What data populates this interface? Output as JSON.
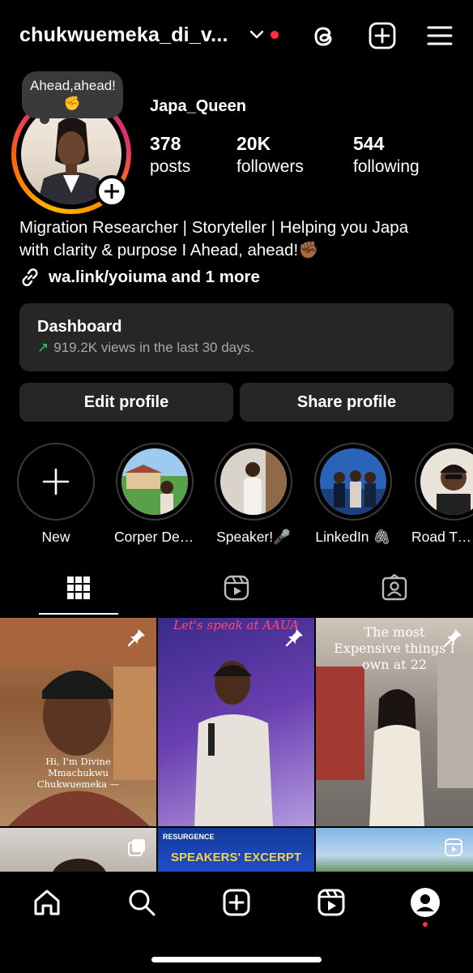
{
  "header": {
    "username": "chukwuemeka_di_v...",
    "icons": [
      "chevron-down-icon",
      "threads-icon",
      "create-plus-icon",
      "menu-icon"
    ],
    "notification_color": "#ff3040"
  },
  "profile": {
    "note": "Ahead,ahead!✊",
    "display_name": "Japa_Queen",
    "stats": [
      {
        "value": "378",
        "label": "posts"
      },
      {
        "value": "20K",
        "label": "followers"
      },
      {
        "value": "544",
        "label": "following"
      }
    ],
    "bio_line1": "Migration Researcher | Storyteller | Helping you Japa",
    "bio_line2": "with clarity & purpose I Ahead, ahead!✊🏾",
    "link_text": "wa.link/yoiuma and 1 more"
  },
  "dashboard": {
    "title": "Dashboard",
    "subtitle": "919.2K views in the last 30 days."
  },
  "buttons": {
    "edit": "Edit profile",
    "share": "Share profile"
  },
  "highlights": [
    {
      "label": "New"
    },
    {
      "label": "Corper Dee..."
    },
    {
      "label": "Speaker!🎤"
    },
    {
      "label": "LinkedIn 🖇"
    },
    {
      "label": "Road Trav"
    }
  ],
  "tabs": [
    "grid-icon",
    "reels-icon",
    "tagged-icon"
  ],
  "posts": [
    {
      "caption": "Hi, I'm Divine Mmachukwu Chukwuemeka —",
      "pinned": true
    },
    {
      "caption": "Let's speak at AAUA",
      "pinned": true
    },
    {
      "caption": "The most Expensive things I own at 22",
      "pinned": true
    },
    {
      "caption": "",
      "type": "carousel"
    },
    {
      "caption": "RESURGENCE",
      "caption2": "SPEAKERS' EXCERPT",
      "type": "image"
    },
    {
      "caption": "",
      "type": "reel"
    }
  ],
  "colors": {
    "background": "#000000",
    "surface": "#262626",
    "accent_green": "#2ecc71",
    "muted": "#a8a8a8"
  }
}
